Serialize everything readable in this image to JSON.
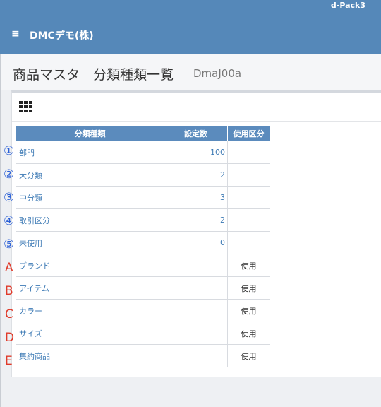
{
  "header": {
    "product": "d-Pack3",
    "menu_icon": "≡",
    "company": "DMCデモ(株)"
  },
  "page": {
    "title": "商品マスタ　分類種類一覧",
    "code": "DmaJ00a"
  },
  "toolbar": {
    "icon": "grid-icon"
  },
  "table": {
    "headers": [
      "分類種類",
      "設定数",
      "使用区分"
    ],
    "rows": [
      {
        "marker": "①",
        "name": "部門",
        "count": "100",
        "usage": ""
      },
      {
        "marker": "②",
        "name": "大分類",
        "count": "2",
        "usage": ""
      },
      {
        "marker": "③",
        "name": "中分類",
        "count": "3",
        "usage": ""
      },
      {
        "marker": "④",
        "name": "取引区分",
        "count": "2",
        "usage": ""
      },
      {
        "marker": "⑤",
        "name": "未使用",
        "count": "0",
        "usage": ""
      },
      {
        "marker": "A",
        "name": "ブランド",
        "count": "",
        "usage": "使用"
      },
      {
        "marker": "B",
        "name": "アイテム",
        "count": "",
        "usage": "使用"
      },
      {
        "marker": "C",
        "name": "カラー",
        "count": "",
        "usage": "使用"
      },
      {
        "marker": "D",
        "name": "サイズ",
        "count": "",
        "usage": "使用"
      },
      {
        "marker": "E",
        "name": "集約商品",
        "count": "",
        "usage": "使用"
      }
    ]
  },
  "colors": {
    "header_bg": "#5588b9",
    "table_header_bg": "#5b8bbd",
    "link_text": "#3d7ab5",
    "marker_blue": "#2a5fd6",
    "marker_red": "#e03a2a"
  }
}
